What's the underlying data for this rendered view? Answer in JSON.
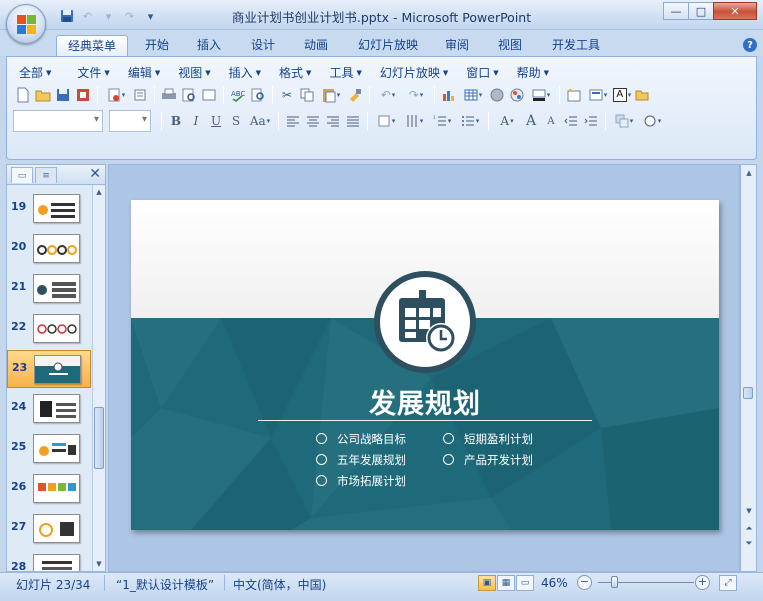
{
  "window": {
    "title": "商业计划书创业计划书.pptx - Microsoft PowerPoint",
    "controls": {
      "minimize": "—",
      "maximize": "□",
      "close": "✕"
    }
  },
  "tabs": [
    {
      "label": "经典菜单",
      "active": true
    },
    {
      "label": "开始"
    },
    {
      "label": "插入"
    },
    {
      "label": "设计"
    },
    {
      "label": "动画"
    },
    {
      "label": "幻灯片放映"
    },
    {
      "label": "审阅"
    },
    {
      "label": "视图"
    },
    {
      "label": "开发工具"
    }
  ],
  "help": "?",
  "menus": [
    "全部",
    "文件",
    "编辑",
    "视图",
    "插入",
    "格式",
    "工具",
    "幻灯片放映",
    "窗口",
    "帮助"
  ],
  "format_buttons": {
    "bold": "B",
    "italic": "I",
    "underline": "U",
    "strike": "S",
    "case": "Aa"
  },
  "font_buttons": {
    "font_color": "A",
    "grow": "A",
    "shrink": "A",
    "text_box": "A"
  },
  "slides_pane": {
    "tab_icons": [
      "slides-tab-icon",
      "outline-tab-icon"
    ],
    "close": "✕",
    "slides": [
      {
        "number": "19"
      },
      {
        "number": "20"
      },
      {
        "number": "21"
      },
      {
        "number": "22"
      },
      {
        "number": "23",
        "selected": true
      },
      {
        "number": "24"
      },
      {
        "number": "25"
      },
      {
        "number": "26"
      },
      {
        "number": "27"
      },
      {
        "number": "28"
      }
    ]
  },
  "slide": {
    "title": "发展规划",
    "bullets_left": [
      "公司战略目标",
      "五年发展规划",
      "市场拓展计划"
    ],
    "bullets_right": [
      "短期盈利计划",
      "产品开发计划"
    ],
    "colors": {
      "teal": "#1e6a7a",
      "emblem": "#2d4f5f",
      "top": "#f4f4f4"
    },
    "icon": "calendar-clock-icon"
  },
  "status": {
    "slide": "幻灯片 23/34",
    "theme": "“1_默认设计模板”",
    "language": "中文(简体，中国)",
    "zoom": "46%",
    "zoom_minus": "−",
    "zoom_plus": "+"
  }
}
